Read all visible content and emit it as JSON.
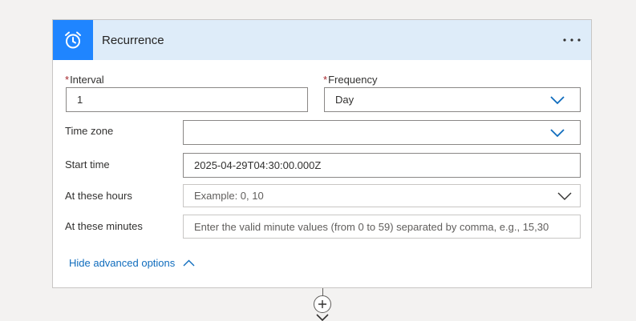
{
  "card": {
    "title": "Recurrence",
    "header_bg": "#deecf9",
    "icon_bg": "#1f85ff",
    "header_icon": "alarm-clock-icon",
    "more_icon": "more-horizontal-icon"
  },
  "fields": {
    "interval": {
      "label": "Interval",
      "required": "*",
      "value": "1"
    },
    "frequency": {
      "label": "Frequency",
      "required": "*",
      "value": "Day"
    },
    "time_zone": {
      "label": "Time zone",
      "value": ""
    },
    "start_time": {
      "label": "Start time",
      "value": "2025-04-29T04:30:00.000Z"
    },
    "hours": {
      "label": "At these hours",
      "placeholder": "Example: 0, 10"
    },
    "minutes": {
      "label": "At these minutes",
      "placeholder": "Enter the valid minute values (from 0 to 59) separated by comma, e.g., 15,30"
    }
  },
  "advanced": {
    "label": "Hide advanced options",
    "color": "#0f6cbd"
  },
  "connector": {
    "add_icon": "plus-icon",
    "arrow_icon": "arrow-down-icon"
  }
}
